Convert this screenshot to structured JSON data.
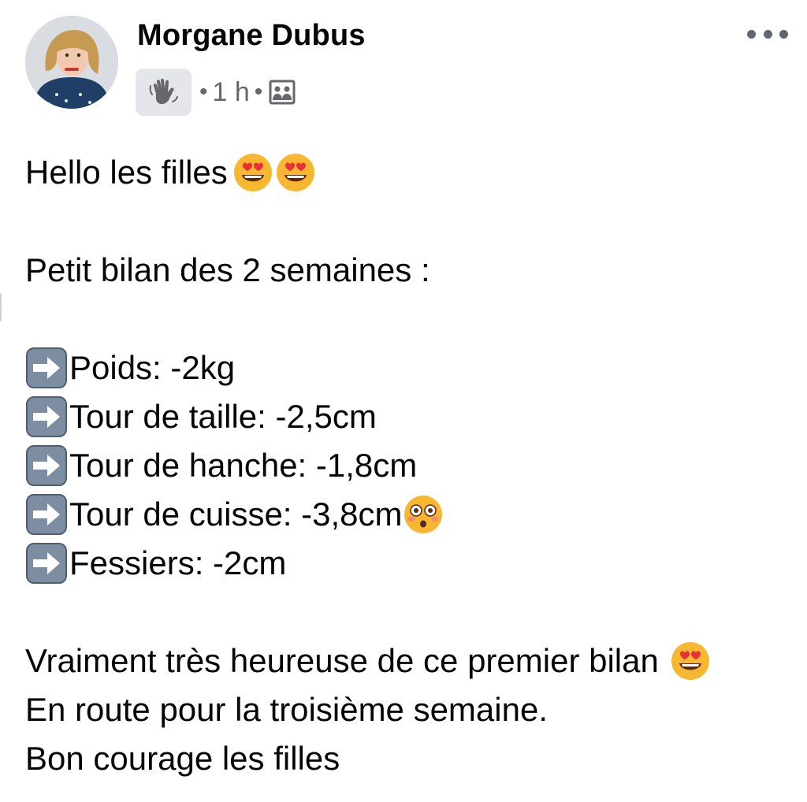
{
  "post": {
    "author": "Morgane Dubus",
    "badge_icon": "waving-hand-icon",
    "separator": "•",
    "time": "1 h",
    "privacy_icon": "group-icon",
    "more_icon": "more-options-icon"
  },
  "body": {
    "greeting": "Hello les filles",
    "intro": "Petit bilan des 2 semaines :",
    "stats": [
      {
        "label": "Poids: -2kg"
      },
      {
        "label": "Tour de taille: -2,5cm"
      },
      {
        "label": "Tour de hanche: -1,8cm"
      },
      {
        "label": "Tour de cuisse: -3,8cm"
      },
      {
        "label": "Fessiers: -2cm"
      }
    ],
    "closing_1": "Vraiment très heureuse de ce premier bilan",
    "closing_2": "En route pour la troisième semaine.",
    "closing_3": "Bon courage les filles"
  },
  "colors": {
    "text": "#050505",
    "meta": "#65676b",
    "badge_bg": "#e4e6eb",
    "arrow_box": "#5b6b80"
  }
}
